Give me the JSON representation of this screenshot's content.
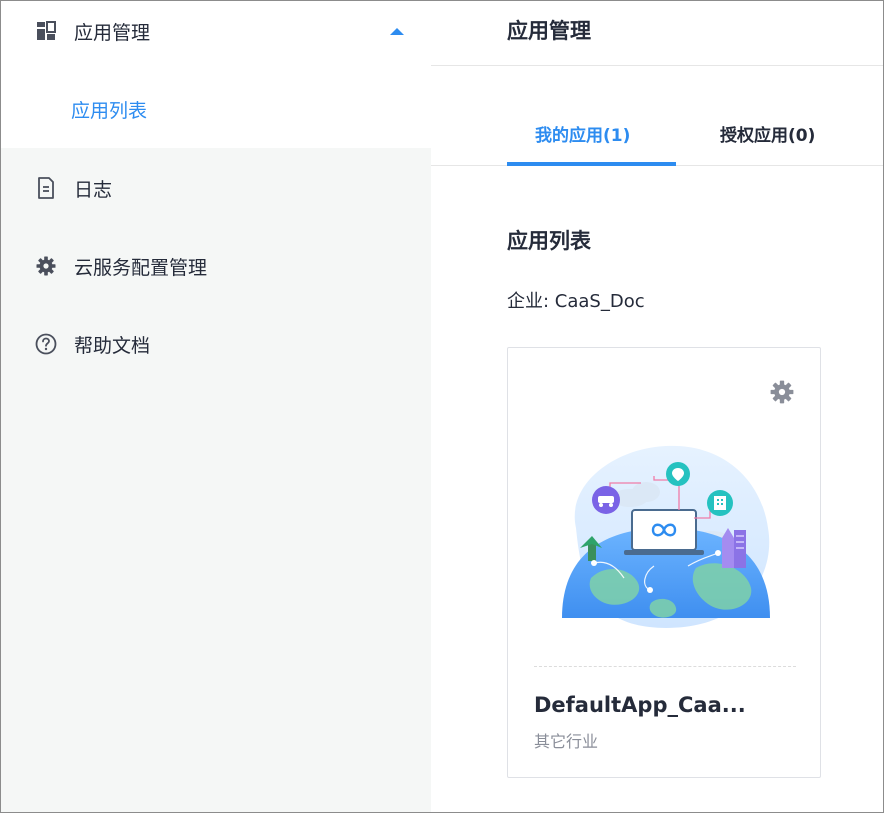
{
  "sidebar": {
    "menu_app_management": {
      "label": "应用管理",
      "icon": "dashboard-icon"
    },
    "submenu_app_list": {
      "label": "应用列表"
    },
    "menu_log": {
      "label": "日志",
      "icon": "document-icon"
    },
    "menu_cloud_config": {
      "label": "云服务配置管理",
      "icon": "gear-icon"
    },
    "menu_help": {
      "label": "帮助文档",
      "icon": "help-icon"
    }
  },
  "main": {
    "page_title": "应用管理",
    "tabs": [
      {
        "label": "我的应用(1)",
        "active": true
      },
      {
        "label": "授权应用(0)",
        "active": false
      }
    ],
    "section_title": "应用列表",
    "enterprise": "企业: CaaS_Doc",
    "cards": [
      {
        "name": "DefaultApp_Caa...",
        "industry": "其它行业",
        "icon": "gear-icon"
      }
    ]
  },
  "colors": {
    "accent": "#2d8cf0",
    "sidebar_bg": "#f5f7f6",
    "text": "#252b3a",
    "muted": "#8a8e99"
  }
}
